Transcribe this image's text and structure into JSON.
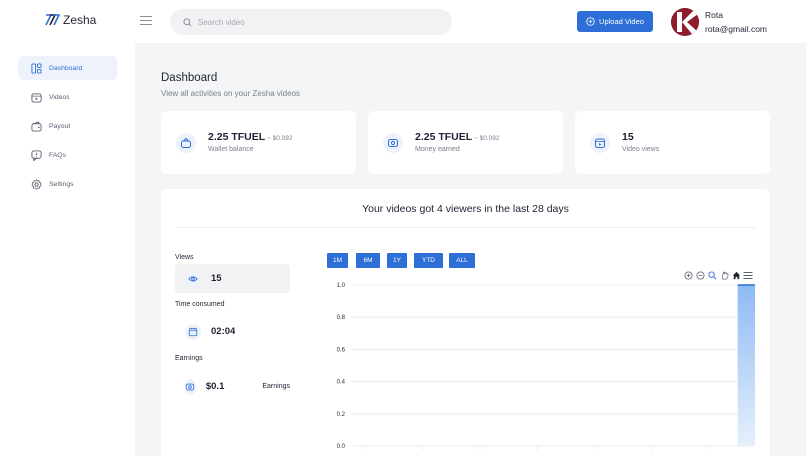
{
  "app": {
    "name": "Zesha"
  },
  "search": {
    "placeholder": "Search video"
  },
  "header": {
    "upload_label": "Upload Video"
  },
  "user": {
    "name": "Rota",
    "email": "rota@gmail.com",
    "avatar_letter": "K"
  },
  "sidebar": {
    "items": [
      {
        "label": "Dashboard",
        "icon": "dashboard-icon",
        "active": true
      },
      {
        "label": "Videos",
        "icon": "video-icon",
        "active": false
      },
      {
        "label": "Payout",
        "icon": "wallet-icon",
        "active": false
      },
      {
        "label": "FAQs",
        "icon": "chat-icon",
        "active": false
      },
      {
        "label": "Settings",
        "icon": "gear-icon",
        "active": false
      }
    ]
  },
  "dashboard": {
    "title": "Dashboard",
    "subtitle": "View all activities on your Zesha videos"
  },
  "cards": [
    {
      "value": "2.25 TFUEL",
      "sub": " ~ $0.092",
      "label": "Wallet balance",
      "icon": "wallet-icon"
    },
    {
      "value": "2.25 TFUEL",
      "sub": " ~ $0.092",
      "label": "Money earned",
      "icon": "money-icon"
    },
    {
      "value": "15",
      "sub": "",
      "label": "Video views",
      "icon": "video-icon"
    }
  ],
  "panel": {
    "title": "Your videos got 4 viewers in the last 28 days",
    "stats": {
      "views_label": "Views",
      "views_value": "15",
      "time_label": "Time consumed",
      "time_value": "02:04",
      "earnings_label": "Earnings",
      "earnings_value": "$0.1",
      "earnings_unit": "Earnings"
    },
    "ranges": [
      "1M",
      "6M",
      "1Y",
      "YTD",
      "ALL"
    ]
  },
  "colors": {
    "accent": "#2d6fd6",
    "bar": "#9fc4f5",
    "avatar": "#8e1c2c"
  },
  "chart_data": {
    "type": "area",
    "yticks": [
      "1.0",
      "0.8",
      "0.6",
      "0.4",
      "0.2",
      "0.0"
    ],
    "ylim": [
      0,
      1
    ],
    "x_count": 28,
    "values": [
      0,
      0,
      0,
      0,
      0,
      0,
      0,
      0,
      0,
      0,
      0,
      0,
      0,
      0,
      0,
      0,
      0,
      0,
      0,
      0,
      0,
      0,
      0,
      0,
      0,
      0,
      0,
      1
    ],
    "grid": true,
    "toolbar_icons": [
      "zoom-in-icon",
      "zoom-out-icon",
      "magnifier-icon",
      "pan-icon",
      "home-icon",
      "menu-icon"
    ]
  }
}
